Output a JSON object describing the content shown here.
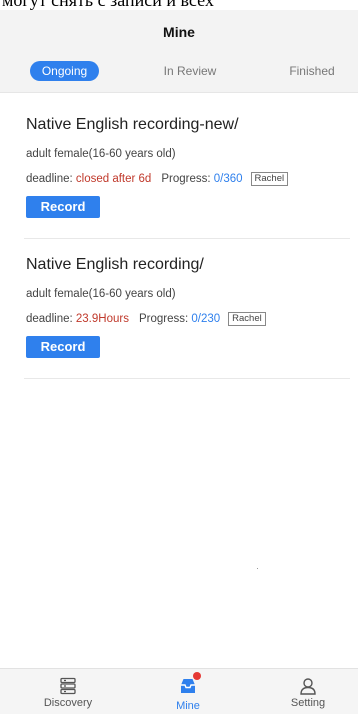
{
  "top_text": "могут снять с записи и всех",
  "header": {
    "title": "Mine"
  },
  "tabs": [
    {
      "label": "Ongoing",
      "active": true
    },
    {
      "label": "In Review",
      "active": false
    },
    {
      "label": "Finished",
      "active": false
    }
  ],
  "tasks": [
    {
      "title": "Native English recording-new/",
      "subtitle": "adult female(16-60 years old)",
      "deadline_label": "deadline:",
      "deadline_value": "closed after 6d",
      "progress_label": "Progress:",
      "progress_value": "0/360",
      "tag": "Rachel",
      "button_label": "Record"
    },
    {
      "title": "Native English recording/",
      "subtitle": "adult female(16-60 years old)",
      "deadline_label": "deadline:",
      "deadline_value": "23.9Hours",
      "progress_label": "Progress:",
      "progress_value": "0/230",
      "tag": "Rachel",
      "button_label": "Record"
    }
  ],
  "bottom_nav": [
    {
      "label": "Discovery",
      "icon": "list-icon",
      "active": false
    },
    {
      "label": "Mine",
      "icon": "inbox-icon",
      "active": true,
      "badge": true
    },
    {
      "label": "Setting",
      "icon": "user-icon",
      "active": false
    }
  ],
  "colors": {
    "accent": "#2f80ed",
    "deadline": "#c0392b",
    "header_bg": "#f3f3f3",
    "badge": "#e53935"
  }
}
